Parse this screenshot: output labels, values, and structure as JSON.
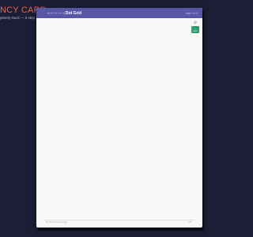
{
  "background": {
    "title": "NCY CARD",
    "subtitle": "pletely stuck — 5 step"
  },
  "card": {
    "header": {
      "brand": "MATRIX·Q",
      "separator": "›",
      "title": "Dot Grid",
      "right_text": "step 1 of 5"
    },
    "controls": {
      "gear_icon": "gear-icon",
      "action_label": "Next",
      "action_icon": "arrow-right-icon"
    },
    "footer": {
      "left_text": "hit Next for more help",
      "right_text": "1/5"
    }
  },
  "colors": {
    "page_background": "#1d1e35",
    "accent_title": "#e06a4e",
    "header": "#5856a6",
    "card": "#f8f8f6",
    "action_button": "#2e9a6e"
  }
}
